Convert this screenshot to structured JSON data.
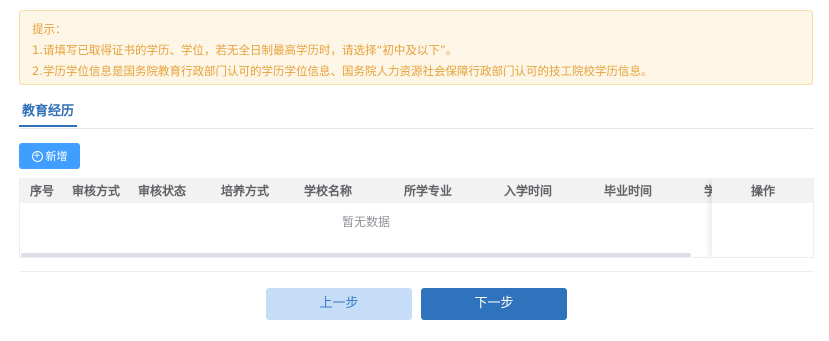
{
  "notice": {
    "title": "提示：",
    "line1": "1.请填写已取得证书的学历、学位，若无全日制最高学历时，请选择“初中及以下”。",
    "line2": "2.学历学位信息是国务院教育行政部门认可的学历学位信息、国务院人力资源社会保障行政部门认可的技工院校学历信息。"
  },
  "tabs": {
    "active": "教育经历"
  },
  "toolbar": {
    "add_label": "新增",
    "add_icon": "plus-circle-icon"
  },
  "table": {
    "columns": [
      "序号",
      "审核方式",
      "审核状态",
      "培养方式",
      "学校名称",
      "所学专业",
      "入学时间",
      "毕业时间",
      "学"
    ],
    "action_column": "操作",
    "empty_text": "暂无数据"
  },
  "footer": {
    "prev_label": "上一步",
    "next_label": "下一步"
  },
  "colors": {
    "accent": "#2e73bb",
    "warning": "#e6a23c",
    "primary": "#409eff"
  }
}
